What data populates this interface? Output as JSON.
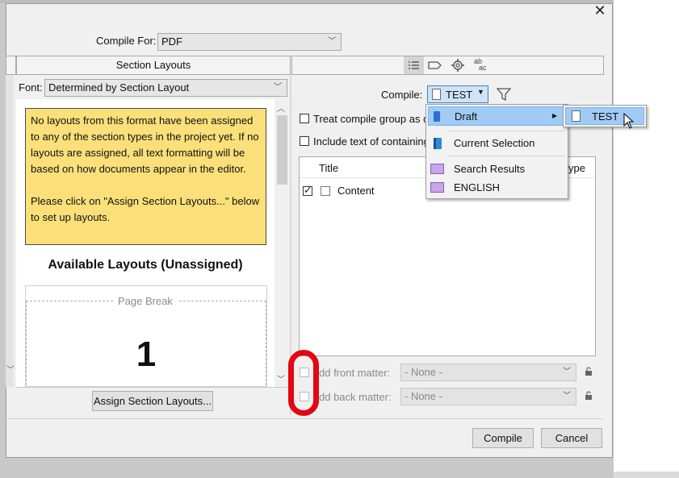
{
  "window": {
    "close_glyph": "✕"
  },
  "compile_for": {
    "label": "Compile For:",
    "value": "PDF"
  },
  "left_panel": {
    "header": "Section Layouts",
    "font_label": "Font:",
    "font_value": "Determined by Section Layout",
    "note_p1": "No layouts from this format have been assigned to any of the section types in the project yet. If no layouts are assigned, all text formatting will be based on how documents appear in the editor.",
    "note_p2": "Please click on \"Assign Section Layouts...\" below to set up layouts.",
    "available_title": "Available Layouts (Unassigned)",
    "layout_card": {
      "label": "Page Break",
      "number": "1"
    },
    "assign_button": "Assign Section Layouts..."
  },
  "right_panel": {
    "toolbar_icons": [
      "list-icon",
      "tag-icon",
      "gear-icon",
      "replace-text-icon"
    ],
    "replace_icon_top": "ab",
    "replace_icon_bottom": "ac",
    "compile_label": "Compile:",
    "compile_value": "TEST",
    "treat_compile_group": "Treat compile group as co",
    "include_text": "Include text of containing",
    "table": {
      "col_title": "Title",
      "col_type": "ype",
      "rows": [
        {
          "included": true,
          "title": "Content"
        }
      ]
    },
    "front_matter_label": "dd front matter:",
    "front_matter_value": "- None -",
    "back_matter_label": "dd back matter:",
    "back_matter_value": "- None -"
  },
  "dropdown_menu": {
    "items": [
      {
        "label": "Draft",
        "icon": "draft-folder-icon",
        "highlighted": true,
        "submenu_arrow": "▸"
      },
      {
        "label": "Current Selection",
        "icon": "current-selection-icon"
      },
      {
        "label": "Search Results",
        "icon": "search-collection-icon"
      },
      {
        "label": "ENGLISH",
        "icon": "search-collection-icon"
      }
    ],
    "submenu": {
      "item": "TEST"
    }
  },
  "footer": {
    "compile_button": "Compile",
    "cancel_button": "Cancel"
  },
  "colors": {
    "note_bg": "#fbe07a",
    "menu_highlight": "#9fcbf5",
    "annotation_ring": "#e30613",
    "dialog_bg": "#f0f0f0"
  }
}
